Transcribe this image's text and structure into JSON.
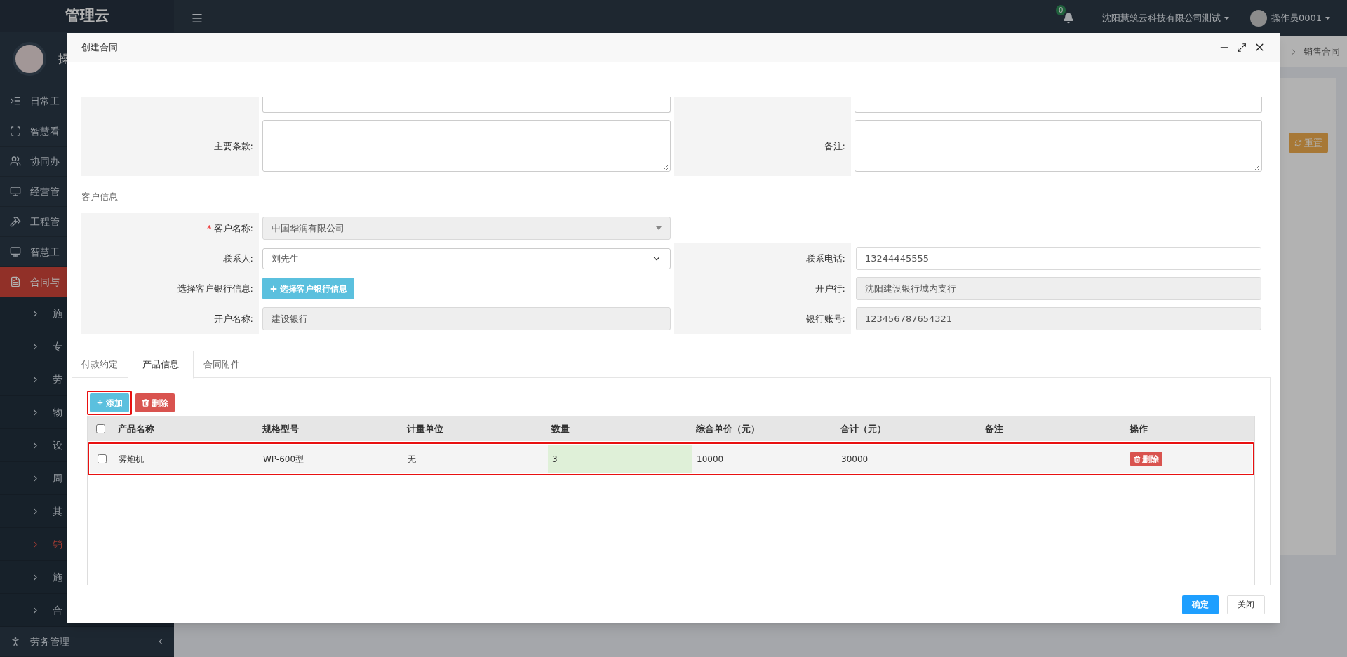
{
  "sidebar": {
    "logo": "管理云",
    "user_name": "操",
    "nav": [
      {
        "label": "日常工",
        "selected": false
      },
      {
        "label": "智慧看",
        "selected": false
      },
      {
        "label": "协同办",
        "selected": false
      },
      {
        "label": "经营管",
        "selected": false
      },
      {
        "label": "工程管",
        "selected": false
      },
      {
        "label": "智慧工",
        "selected": false
      },
      {
        "label": "合同与",
        "selected": true,
        "expanded": true,
        "children": [
          {
            "label": "施",
            "selected": false
          },
          {
            "label": "专",
            "selected": false
          },
          {
            "label": "劳",
            "selected": false
          },
          {
            "label": "物",
            "selected": false
          },
          {
            "label": "设",
            "selected": false
          },
          {
            "label": "周",
            "selected": false
          },
          {
            "label": "其",
            "selected": false
          },
          {
            "label": "销",
            "selected": true
          },
          {
            "label": "施",
            "selected": false
          },
          {
            "label": "合",
            "selected": false
          }
        ]
      },
      {
        "label": "劳务管理",
        "selected": false,
        "expanded": false
      }
    ]
  },
  "header": {
    "notification_count": "0",
    "company": "沈阳慧筑云科技有限公司测试",
    "user": "操作员0001"
  },
  "page": {
    "breadcrumb": "销售合同",
    "reset_button": "重置"
  },
  "modal": {
    "title": "创建合同",
    "form_rows": [
      {
        "left": {
          "kind": "input"
        },
        "right": {
          "kind": "input"
        }
      },
      {
        "left": {
          "kind": "textarea",
          "label": "主要条款:"
        },
        "right": {
          "kind": "textarea",
          "label": "备注:"
        }
      }
    ],
    "customer_section": {
      "title": "客户信息",
      "rows": [
        {
          "left": {
            "kind": "combo",
            "label": "客户名称:",
            "required_mark": "*",
            "value": "中国华润有限公司",
            "disabled": true
          }
        },
        {
          "left": {
            "kind": "select",
            "label": "联系人:",
            "value": "刘先生",
            "disabled": false
          },
          "right": {
            "kind": "input",
            "label": "联系电话:",
            "value": "13244445555",
            "disabled": false
          }
        },
        {
          "left": {
            "kind": "button",
            "label": "选择客户银行信息:",
            "value": "选择客户银行信息",
            "disabled": false
          },
          "right": {
            "kind": "input",
            "label": "开户行:",
            "value": "沈阳建设银行城内支行",
            "disabled": true
          }
        },
        {
          "left": {
            "kind": "input",
            "label": "开户名称:",
            "value": "建设银行",
            "disabled": true
          },
          "right": {
            "kind": "input",
            "label": "银行账号:",
            "value": "123456787654321",
            "disabled": true
          }
        }
      ]
    },
    "tabs": [
      {
        "label": "付款约定",
        "selected": false
      },
      {
        "label": "产品信息",
        "selected": true
      },
      {
        "label": "合同附件",
        "selected": false
      }
    ],
    "toolbar": [
      {
        "kind": "add",
        "label": "添加",
        "highlighted": true
      },
      {
        "kind": "delete",
        "label": "删除",
        "highlighted": false
      }
    ],
    "table": {
      "select_all_checked": false,
      "columns": [
        "产品名称",
        "规格型号",
        "计量单位",
        "数量",
        "综合单价（元）",
        "合计（元）",
        "备注",
        "操作"
      ],
      "rows": [
        {
          "checked": false,
          "highlighted": true,
          "quantity_editing": true,
          "product": "雾炮机",
          "model": "WP-600型",
          "unit": "无",
          "quantity": "3",
          "unit_price": "10000",
          "total": "30000",
          "action": "删除"
        }
      ]
    },
    "footer_buttons": [
      {
        "kind": "primary",
        "label": "确定"
      },
      {
        "kind": "default",
        "label": "关闭"
      }
    ]
  }
}
